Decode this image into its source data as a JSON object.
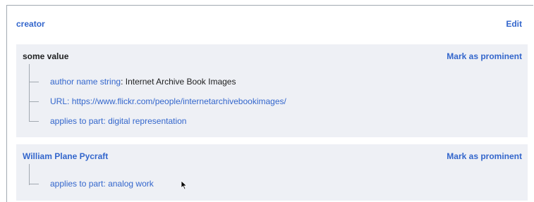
{
  "property": {
    "name": "creator",
    "edit_label": "Edit"
  },
  "statements": [
    {
      "value": "some value",
      "rank_action": "Mark as prominent",
      "qualifiers": [
        {
          "property": "author name string",
          "separator": ": ",
          "value": "Internet Archive Book Images"
        },
        {
          "property": "URL",
          "separator": ": ",
          "value": "https://www.flickr.com/people/internetarchivebookimages/"
        },
        {
          "property": "applies to part",
          "separator": ": ",
          "value": "digital representation"
        }
      ]
    },
    {
      "value": "William Plane Pycraft",
      "rank_action": "Mark as prominent",
      "qualifiers": [
        {
          "property": "applies to part",
          "separator": ": ",
          "value": "analog work"
        }
      ]
    }
  ],
  "icons": {
    "cursor": "mouse-pointer-icon"
  },
  "colors": {
    "link": "#3366cc",
    "statement_bg": "#eef0f5",
    "text": "#202122",
    "tree_line": "#a2a9b1"
  }
}
